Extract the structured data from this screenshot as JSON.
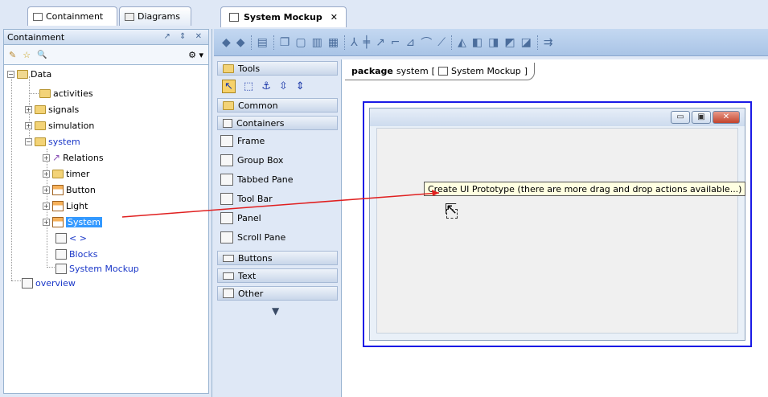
{
  "left_tabs": {
    "containment": "Containment",
    "diagrams": "Diagrams"
  },
  "panel": {
    "title": "Containment",
    "controls": "↗ ⇕ ✕",
    "tools": {
      "new": "✎",
      "favorite": "☆",
      "search": "🔍",
      "options": "⚙ ▾"
    }
  },
  "tree": [
    {
      "label": "Data",
      "expander": "−"
    },
    {
      "label": "activities"
    },
    {
      "label": "signals",
      "expander": "+"
    },
    {
      "label": "simulation",
      "expander": "+"
    },
    {
      "label": "system",
      "expander": "−"
    },
    {
      "label": "Relations",
      "expander": "+"
    },
    {
      "label": "timer",
      "expander": "+"
    },
    {
      "label": "Button",
      "expander": "+"
    },
    {
      "label": "Light",
      "expander": "+"
    },
    {
      "label": "System",
      "expander": "+"
    },
    {
      "label": "< >"
    },
    {
      "label": "Blocks"
    },
    {
      "label": "System Mockup"
    },
    {
      "label": "overview"
    }
  ],
  "editor": {
    "tab_title": "System Mockup",
    "tab_close": "✕"
  },
  "palette": {
    "tools": "Tools",
    "common": "Common",
    "containers": "Containers",
    "items": [
      "Frame",
      "Group Box",
      "Tabbed Pane",
      "Tool Bar",
      "Panel",
      "Scroll Pane"
    ],
    "buttons": "Buttons",
    "text": "Text",
    "other": "Other",
    "more_arrow": "▼"
  },
  "canvas": {
    "pkg_keyword": "package",
    "pkg_name": "system",
    "pkg_diagram": "System Mockup",
    "tooltip": "Create UI Prototype (there are more drag and drop actions available...)"
  },
  "window_buttons": {
    "minimize": "▭",
    "maximize": "▣",
    "close": "✕"
  },
  "colors": {
    "selection": "#3399ff",
    "frame_border": "#1a1ae6",
    "drag_arrow": "#e02020",
    "tooltip_bg": "#ffffe1"
  }
}
